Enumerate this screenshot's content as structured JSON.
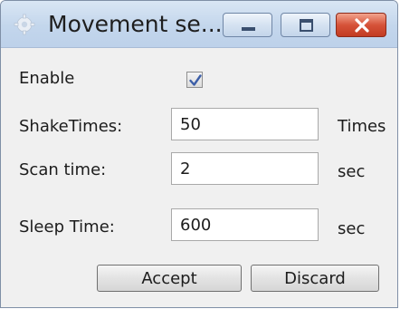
{
  "window": {
    "title": "Movement se...",
    "app_icon": "gear-icon",
    "caption_buttons": {
      "minimize_icon": "minimize-icon",
      "maximize_icon": "maximize-icon",
      "close_icon": "close-icon"
    }
  },
  "form": {
    "enable": {
      "label": "Enable",
      "checked": true
    },
    "shake_times": {
      "label": "ShakeTimes:",
      "value": "50",
      "unit": "Times"
    },
    "scan_time": {
      "label": "Scan time:",
      "value": "2",
      "unit": "sec"
    },
    "sleep_time": {
      "label": "Sleep Time:",
      "value": "600",
      "unit": "sec"
    }
  },
  "buttons": {
    "accept": "Accept",
    "discard": "Discard"
  },
  "colors": {
    "titlebar": "#c3d6ec",
    "close_button": "#d6533a",
    "checkmark": "#3d5fa8",
    "window_background": "#f0f0f0"
  }
}
